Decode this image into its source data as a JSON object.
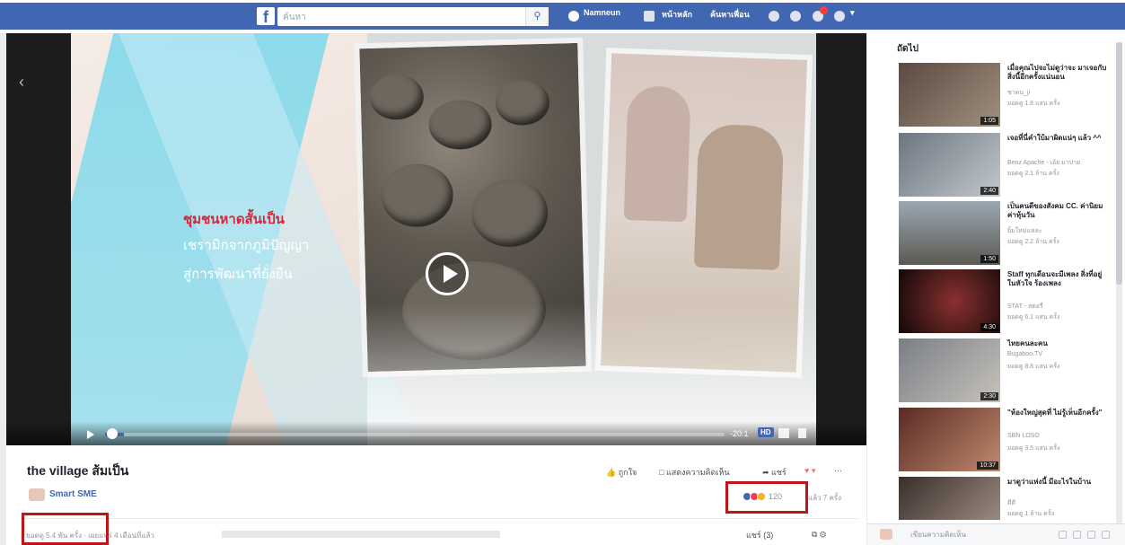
{
  "topbar": {
    "logo": "f",
    "search_placeholder": "ค้นหา",
    "search_icon": "search-icon",
    "nav": [
      "Namneun",
      "หน้าหลัก",
      "ค้นหาเพื่อน"
    ],
    "accent": "#4267b2"
  },
  "video": {
    "overlay_line1": "ชุมชนหาดสั้นเป็น",
    "overlay_line2": "เชรามิกจากภูมิปัญญา",
    "overlay_line3": "สู่การพัฒนาที่ยั่งยืน",
    "time": "-20:1",
    "quality": "HD",
    "progress": 0.03
  },
  "info": {
    "title": "the village ส้มเป็น",
    "actions": [
      "ถูกใจ",
      "แสดงความคิดเห็น",
      "แชร์"
    ],
    "page_name": "Smart SME",
    "reaction_count": "120",
    "views": "แล้ว 7 ครั้ง",
    "meta": "ยอดดู 5.4 พัน ครั้ง · เผยแพร่ 4 เดือนที่แล้ว",
    "share_count": "แชร์ (3)"
  },
  "sidebar": {
    "header": "ถัดไป",
    "videos": [
      {
        "title": "เมื่อคุณไปจะไม่ดูว่าจะ มาเจอกับสิ่งนี้อีกครั้งแน่นอน",
        "channel": "ชาคน_ji",
        "views": "ยอดดู 1.8 แสน ครั้ง",
        "duration": "1:05"
      },
      {
        "title": "เจอที่นี่คำใบ้มาผิดแน่ๆ แล้ว ^^",
        "channel": "Benz Apache - เอ้ย มาปาย",
        "views": "ยอดดู 2.1 ล้าน ครั้ง",
        "duration": "2:40"
      },
      {
        "title": "เป็นคนดีของสังคม CC. ค่านิยม ค่าหุ้นวัน",
        "channel": "ยิ้มใหม่แหละ",
        "views": "ยอดดู 2.2 ล้าน ครั้ง",
        "duration": "1:50"
      },
      {
        "title": "Staff ทุกเดือนจะมีเพลง สิ่งที่อยู่ในหัวใจ ร้องเพลง",
        "channel": "STAT - สตอรี่",
        "views": "ยอดดู 6.1 แสน ครั้ง",
        "duration": "4:30"
      },
      {
        "title": "ไทยคนละคน",
        "channel": "Bugaboo.TV",
        "views": "ยอดดู 8.8 แสน ครั้ง",
        "duration": "2:30"
      },
      {
        "title": "\"ห้องใหญ่สุดที่ ไม่รู้เห็นอีกครั้ง\"",
        "channel": "SBN LOSO",
        "views": "ยอดดู 3.5 แสน ครั้ง",
        "duration": "10:37"
      },
      {
        "title": "มาดูว่าแห่งนี้ มีอะไรในบ้าน",
        "channel": "ดีดี",
        "views": "ยอดดู 1 ล้าน ครั้ง",
        "duration": ""
      }
    ],
    "chat_placeholder": "เขียนความคิดเห็น"
  }
}
